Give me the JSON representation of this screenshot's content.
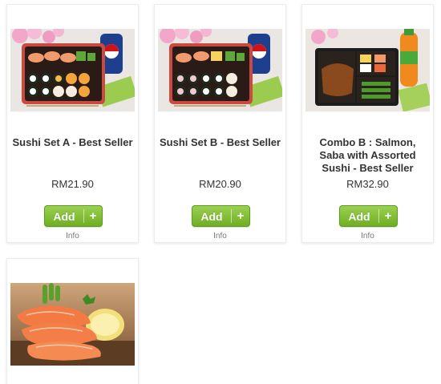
{
  "products": [
    {
      "name": "Sushi Set A - Best Seller",
      "price": "RM21.90",
      "add_label": "Add",
      "plus": "+",
      "info_label": "Info",
      "image": "sushi-set-a-photo"
    },
    {
      "name": "Sushi Set B - Best Seller",
      "price": "RM20.90",
      "add_label": "Add",
      "plus": "+",
      "info_label": "Info",
      "image": "sushi-set-b-photo"
    },
    {
      "name": "Combo B : Salmon, Saba with Assorted Sushi - Best Seller",
      "price": "RM32.90",
      "add_label": "Add",
      "plus": "+",
      "info_label": "Info",
      "image": "combo-b-photo"
    },
    {
      "image": "salmon-sashimi-photo"
    }
  ],
  "colors": {
    "button_green": "#7cbf2c",
    "text": "#333333",
    "info": "#777777"
  }
}
